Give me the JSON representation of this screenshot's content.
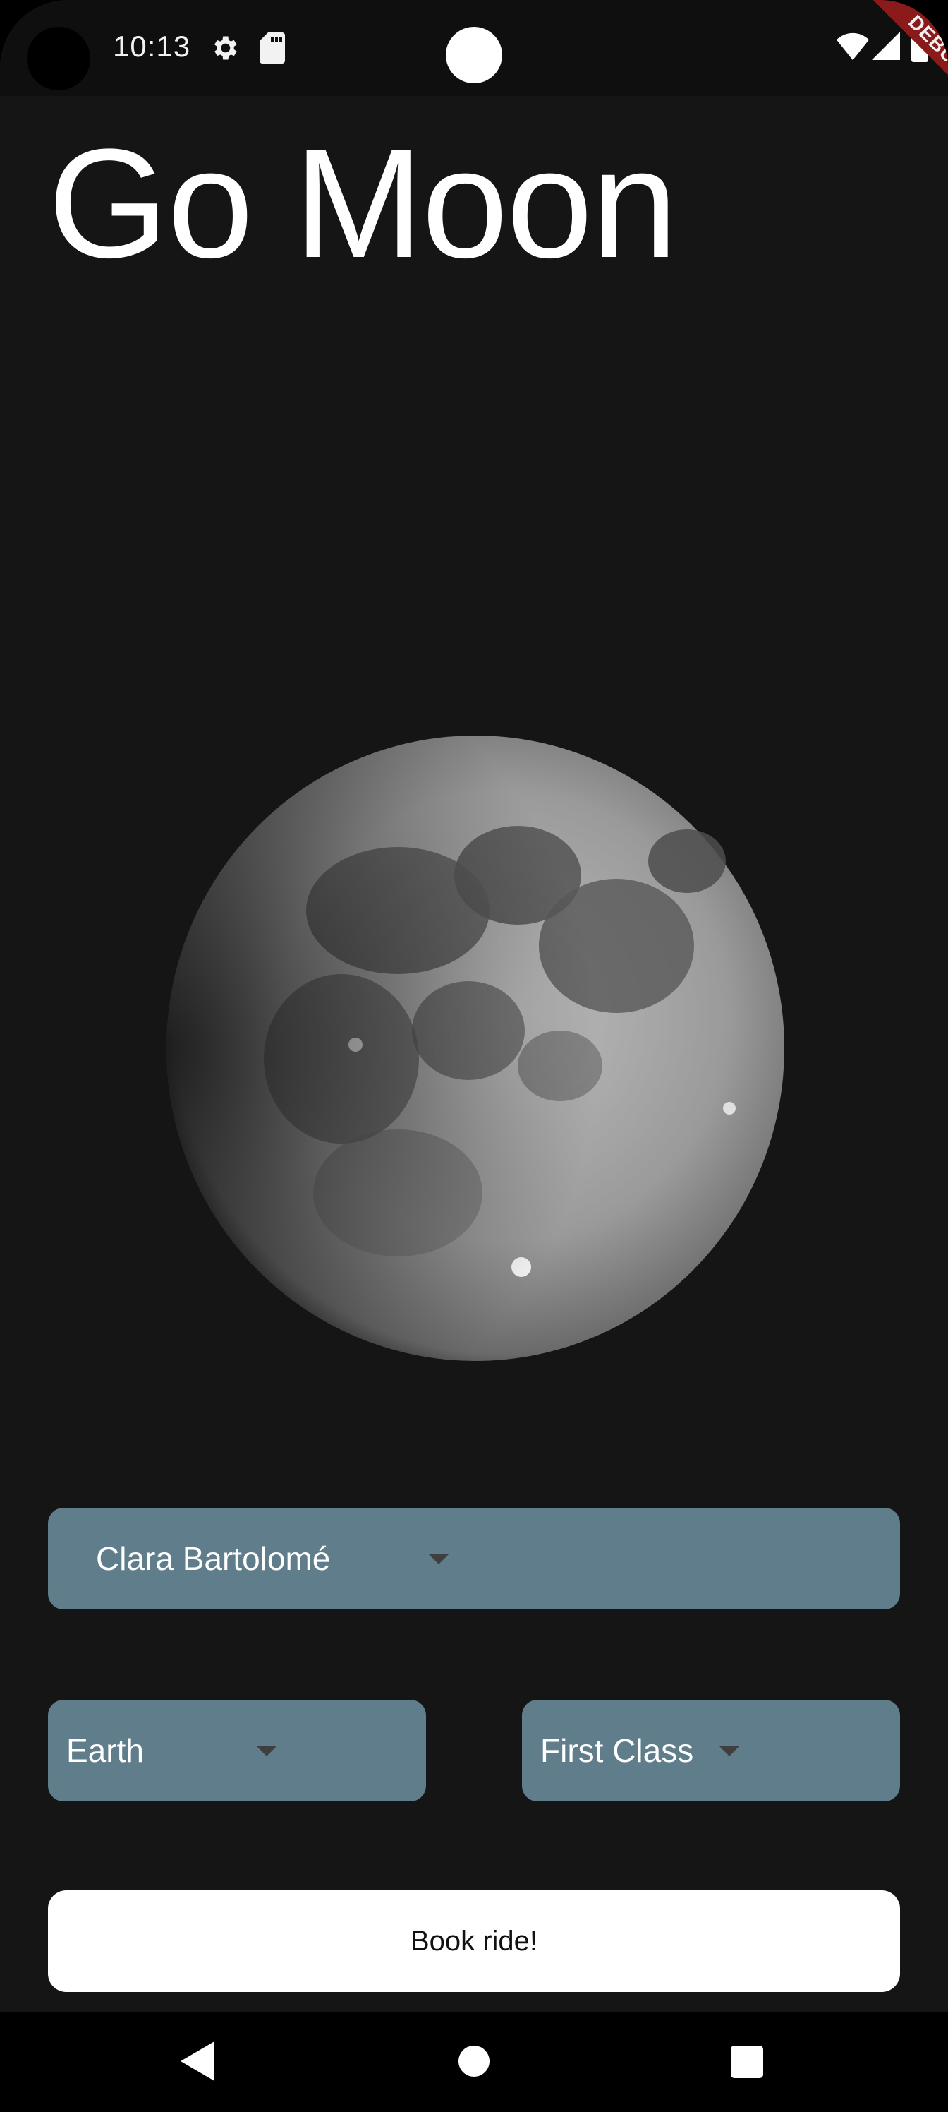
{
  "status_bar": {
    "time": "10:13",
    "icons": [
      "camera-cutout",
      "gear-icon",
      "sd-card-icon",
      "notification-dot",
      "wifi-icon",
      "signal-icon",
      "battery-icon"
    ],
    "debug_label": "DEBUG"
  },
  "app": {
    "title": "Go Moon",
    "hero_image": "moon-image"
  },
  "form": {
    "user_select": {
      "selected": "Clara Bartolomé"
    },
    "destination_select": {
      "selected": "Earth"
    },
    "class_select": {
      "selected": "First Class"
    },
    "book_button_label": "Book ride!"
  },
  "nav_bar": {
    "icons": [
      "back-icon",
      "home-icon",
      "recents-icon"
    ]
  },
  "colors": {
    "background": "#151515",
    "dropdown": "#607d8b",
    "button": "#ffffff",
    "text": "#ffffff"
  }
}
